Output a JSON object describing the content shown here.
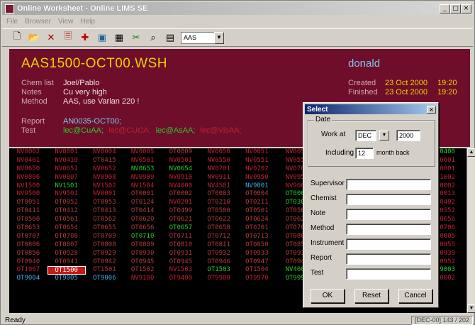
{
  "window": {
    "title": "Online Worksheet - Online LIMS SE",
    "controls": [
      "_",
      "□",
      "×"
    ]
  },
  "menu": [
    "File",
    "Browser",
    "View",
    "Help"
  ],
  "toolbar": {
    "icons": [
      "new-icon",
      "open-icon",
      "delete-icon",
      "info-icon",
      "insert-icon",
      "image-icon",
      "calc-icon",
      "cut-icon",
      "find-icon",
      "table-icon"
    ],
    "combo_value": "AAS"
  },
  "header": {
    "worksheet_name": "AAS1500-OCT00.WSH",
    "user": "donald",
    "chem_list_label": "Chem list",
    "chem_list": "Joel/Pablo",
    "notes_label": "Notes",
    "notes": "Cu very high",
    "method_label": "Method",
    "method": "AAS, use Varian 220 !",
    "report_label": "Report",
    "report": "AN0035-OCT00;",
    "test_label": "Test",
    "tests": [
      {
        "text": "lec@CuAA;",
        "color": "#28c828"
      },
      {
        "text": "lec@CUCA;",
        "color": "#c02030"
      },
      {
        "text": "lec@AsAA;",
        "color": "#28c828"
      },
      {
        "text": "lec@VisAA;",
        "color": "#c02030"
      }
    ],
    "created_label": "Created",
    "created_date": "23 Oct 2000",
    "created_time": "19:20",
    "finished_label": "Finished",
    "finished_date": "23 Oct 2000",
    "finished_time": "19:20"
  },
  "grid": [
    [
      [
        "NV0002",
        "r"
      ],
      [
        "NV0001",
        "r"
      ],
      [
        "NV0004",
        "r"
      ],
      [
        "NV0005",
        "r"
      ],
      [
        "OT0009",
        "d"
      ],
      [
        "NV0050",
        "r"
      ],
      [
        "NV0051",
        "r"
      ],
      [
        "NV005",
        "r"
      ],
      [
        "",
        "r"
      ],
      [
        "",
        "r"
      ],
      [
        "",
        "r"
      ],
      [
        "0400",
        "g"
      ]
    ],
    [
      [
        "NV0401",
        "r"
      ],
      [
        "NV0410",
        "r"
      ],
      [
        "OT0415",
        "d"
      ],
      [
        "NV0501",
        "r"
      ],
      [
        "NV0501",
        "r"
      ],
      [
        "NV0550",
        "r"
      ],
      [
        "NV0551",
        "r"
      ],
      [
        "NV055",
        "r"
      ],
      [
        "",
        "r"
      ],
      [
        "",
        "r"
      ],
      [
        "",
        "r"
      ],
      [
        "0601",
        "r"
      ]
    ],
    [
      [
        "NV0650",
        "r"
      ],
      [
        "NV0651",
        "r"
      ],
      [
        "NV0652",
        "r"
      ],
      [
        "NV0653",
        "g"
      ],
      [
        "NV0654",
        "g"
      ],
      [
        "NV0701",
        "r"
      ],
      [
        "NV0702",
        "r"
      ],
      [
        "NV070",
        "r"
      ],
      [
        "",
        "r"
      ],
      [
        "",
        "r"
      ],
      [
        "",
        "r"
      ],
      [
        "0801",
        "r"
      ]
    ],
    [
      [
        "NV0806",
        "r"
      ],
      [
        "NV0807",
        "r"
      ],
      [
        "NV0908",
        "r"
      ],
      [
        "NV0909",
        "r"
      ],
      [
        "NV0910",
        "r"
      ],
      [
        "NV0911",
        "r"
      ],
      [
        "NV0950",
        "r"
      ],
      [
        "NV095",
        "r"
      ],
      [
        "",
        "r"
      ],
      [
        "",
        "r"
      ],
      [
        "",
        "r"
      ],
      [
        "1002",
        "r"
      ]
    ],
    [
      [
        "NV1500",
        "r"
      ],
      [
        "NV1501",
        "g"
      ],
      [
        "NV1502",
        "r"
      ],
      [
        "NV1504",
        "r"
      ],
      [
        "NV4000",
        "r"
      ],
      [
        "NV4501",
        "r"
      ],
      [
        "NV9001",
        "b"
      ],
      [
        "NV900",
        "r"
      ],
      [
        "",
        "r"
      ],
      [
        "",
        "r"
      ],
      [
        "",
        "r"
      ],
      [
        "0002",
        "r"
      ]
    ],
    [
      [
        "NV9500",
        "r"
      ],
      [
        "NV9501",
        "r"
      ],
      [
        "NV0001",
        "r"
      ],
      [
        "OT0001",
        "d"
      ],
      [
        "OT0002",
        "d"
      ],
      [
        "OT0003",
        "d"
      ],
      [
        "OT0004",
        "d"
      ],
      [
        "OT000",
        "g"
      ],
      [
        "",
        "r"
      ],
      [
        "",
        "r"
      ],
      [
        "",
        "r"
      ],
      [
        "0013",
        "r"
      ]
    ],
    [
      [
        "OT0051",
        "d"
      ],
      [
        "OT0052",
        "d"
      ],
      [
        "OT0053",
        "d"
      ],
      [
        "OT0124",
        "d"
      ],
      [
        "NV0201",
        "r"
      ],
      [
        "OT0210",
        "d"
      ],
      [
        "OT0211",
        "d"
      ],
      [
        "OT030",
        "g"
      ],
      [
        "",
        "r"
      ],
      [
        "",
        "r"
      ],
      [
        "",
        "r"
      ],
      [
        "0402",
        "r"
      ]
    ],
    [
      [
        "OT0411",
        "d"
      ],
      [
        "OT0412",
        "d"
      ],
      [
        "OT0413",
        "d"
      ],
      [
        "OT0414",
        "d"
      ],
      [
        "OT0499",
        "d"
      ],
      [
        "OT0500",
        "d"
      ],
      [
        "OT0501",
        "d"
      ],
      [
        "OT050",
        "d"
      ],
      [
        "",
        "r"
      ],
      [
        "",
        "r"
      ],
      [
        "",
        "r"
      ],
      [
        "0552",
        "r"
      ]
    ],
    [
      [
        "OT0560",
        "d"
      ],
      [
        "OT0561",
        "d"
      ],
      [
        "OT0562",
        "d"
      ],
      [
        "OT0620",
        "d"
      ],
      [
        "OT0621",
        "d"
      ],
      [
        "OT0622",
        "d"
      ],
      [
        "OT0624",
        "d"
      ],
      [
        "OT062",
        "d"
      ],
      [
        "",
        "r"
      ],
      [
        "",
        "r"
      ],
      [
        "",
        "r"
      ],
      [
        "0656",
        "r"
      ]
    ],
    [
      [
        "OT0653",
        "d"
      ],
      [
        "OT0654",
        "d"
      ],
      [
        "OT0655",
        "d"
      ],
      [
        "OT0656",
        "d"
      ],
      [
        "OT0657",
        "g"
      ],
      [
        "OT0658",
        "d"
      ],
      [
        "OT0701",
        "d"
      ],
      [
        "OT070",
        "d"
      ],
      [
        "",
        "r"
      ],
      [
        "",
        "r"
      ],
      [
        "",
        "r"
      ],
      [
        "0706",
        "r"
      ]
    ],
    [
      [
        "OT0707",
        "d"
      ],
      [
        "OT0708",
        "d"
      ],
      [
        "OT0709",
        "d"
      ],
      [
        "OT0710",
        "g"
      ],
      [
        "OT0711",
        "d"
      ],
      [
        "OT0712",
        "d"
      ],
      [
        "OT0713",
        "d"
      ],
      [
        "OT080",
        "d"
      ],
      [
        "",
        "r"
      ],
      [
        "",
        "r"
      ],
      [
        "",
        "r"
      ],
      [
        "0805",
        "r"
      ]
    ],
    [
      [
        "OT0806",
        "d"
      ],
      [
        "OT0807",
        "d"
      ],
      [
        "OT0808",
        "d"
      ],
      [
        "OT0809",
        "d"
      ],
      [
        "OT0810",
        "d"
      ],
      [
        "OT0811",
        "d"
      ],
      [
        "OT0850",
        "d"
      ],
      [
        "OT085",
        "d"
      ],
      [
        "",
        "r"
      ],
      [
        "",
        "r"
      ],
      [
        "",
        "r"
      ],
      [
        "0855",
        "r"
      ]
    ],
    [
      [
        "OT0856",
        "d"
      ],
      [
        "OT0928",
        "d"
      ],
      [
        "OT0929",
        "d"
      ],
      [
        "OT0930",
        "d"
      ],
      [
        "OT0931",
        "d"
      ],
      [
        "OT0932",
        "d"
      ],
      [
        "OT0933",
        "d"
      ],
      [
        "OT093",
        "d"
      ],
      [
        "",
        "r"
      ],
      [
        "",
        "r"
      ],
      [
        "",
        "r"
      ],
      [
        "0939",
        "r"
      ]
    ],
    [
      [
        "OT0940",
        "d"
      ],
      [
        "OT0941",
        "d"
      ],
      [
        "OT0942",
        "d"
      ],
      [
        "OT0945",
        "d"
      ],
      [
        "OT0945",
        "d"
      ],
      [
        "OT0946",
        "d"
      ],
      [
        "OT0947",
        "d"
      ],
      [
        "OT094",
        "d"
      ],
      [
        "",
        "r"
      ],
      [
        "",
        "r"
      ],
      [
        "",
        "r"
      ],
      [
        "0952",
        "r"
      ]
    ],
    [
      [
        "OT1007",
        "r"
      ],
      [
        "OT1500",
        "sel"
      ],
      [
        "OT1501",
        "d"
      ],
      [
        "OT1502",
        "d"
      ],
      [
        "NV1503",
        "r"
      ],
      [
        "OT1503",
        "g"
      ],
      [
        "OT1504",
        "d"
      ],
      [
        "NV400",
        "g"
      ],
      [
        "",
        "r"
      ],
      [
        "",
        "r"
      ],
      [
        "",
        "r"
      ],
      [
        "9003",
        "g"
      ]
    ],
    [
      [
        "OT9004",
        "b"
      ],
      [
        "OT9005",
        "b"
      ],
      [
        "OT9006",
        "b"
      ],
      [
        "NV9100",
        "r"
      ],
      [
        "OT9400",
        "r"
      ],
      [
        "OT9900",
        "r"
      ],
      [
        "OT9970",
        "r"
      ],
      [
        "OT999",
        "g"
      ],
      [
        "",
        "r"
      ],
      [
        "",
        "r"
      ],
      [
        "",
        "r"
      ],
      [
        "0002",
        "r"
      ]
    ]
  ],
  "status": {
    "text": "Ready",
    "right": "[DEC-00] 143 / 202"
  },
  "dialog": {
    "title": "Select",
    "date_group": "Date",
    "work_at_label": "Work at",
    "month": "DEC",
    "year": "2000",
    "including_label": "Including",
    "months_back": "12",
    "months_back_label": "month back",
    "fields": [
      {
        "label": "Supervisor",
        "value": ""
      },
      {
        "label": "Chemist",
        "value": ""
      },
      {
        "label": "Note",
        "value": ""
      },
      {
        "label": "Method",
        "value": ""
      },
      {
        "label": "Instrument",
        "value": ""
      },
      {
        "label": "Report",
        "value": ""
      },
      {
        "label": "Test",
        "value": ""
      }
    ],
    "ok": "OK",
    "reset": "Reset",
    "cancel": "Cancel"
  }
}
